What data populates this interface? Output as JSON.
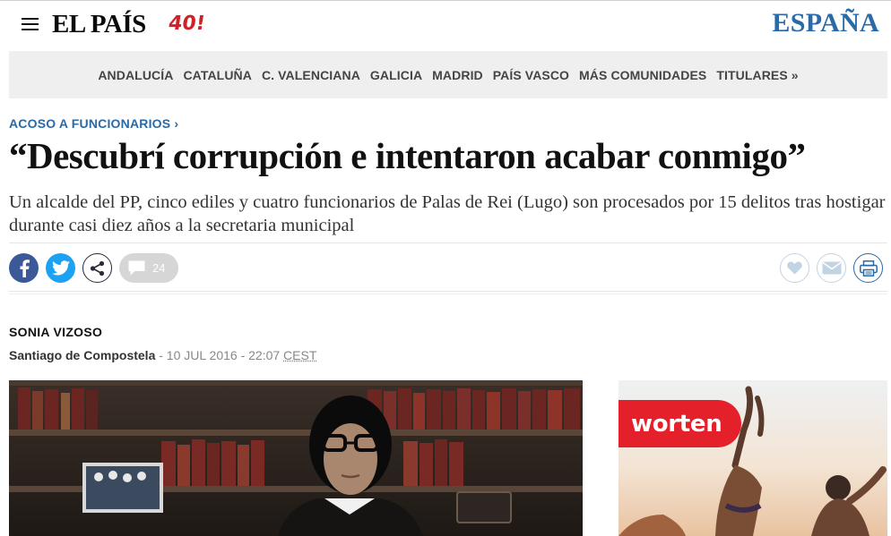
{
  "header": {
    "logo_text": "EL PAÍS",
    "logo_badge": "40!",
    "edition": "ESPAÑA"
  },
  "regions": [
    "ANDALUCÍA",
    "CATALUÑA",
    "C. VALENCIANA",
    "GALICIA",
    "MADRID",
    "PAÍS VASCO",
    "MÁS COMUNIDADES",
    "TITULARES »"
  ],
  "article": {
    "kicker": "ACOSO A FUNCIONARIOS ›",
    "headline": "“Descubrí corrupción e intentaron acabar conmigo”",
    "subhead": "Un alcalde del PP, cinco ediles y cuatro funcionarios de Palas de Rei (Lugo) son procesados por 15 delitos tras hostigar durante casi diez años a la secretaria municipal",
    "author": "SONIA VIZOSO",
    "place": "Santiago de Compostela",
    "date": "- 10 JUL 2016 - 22:07",
    "timezone": "CEST"
  },
  "share": {
    "comments_count": "24",
    "icons": [
      "facebook-icon",
      "twitter-icon",
      "share-icon",
      "comment-icon"
    ]
  },
  "tools": {
    "icons": [
      "heart-icon",
      "mail-icon",
      "print-icon"
    ]
  },
  "ad": {
    "brand": "worten"
  },
  "colors": {
    "brand_blue": "#2a6aa6",
    "brand_red": "#d22028",
    "facebook": "#3b5998",
    "twitter": "#1da1f2",
    "ad_red": "#e4202b"
  }
}
